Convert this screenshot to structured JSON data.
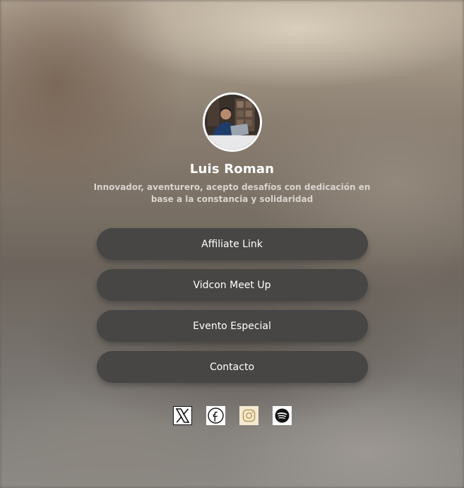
{
  "profile": {
    "name": "Luis Roman",
    "bio": "Innovador, aventurero, acepto desafíos con dedicación en base a la constancia y solidaridad"
  },
  "links": [
    {
      "label": "Affiliate Link"
    },
    {
      "label": "Vidcon Meet Up"
    },
    {
      "label": "Evento Especial"
    },
    {
      "label": "Contacto"
    }
  ],
  "socials": [
    {
      "icon": "x-twitter-icon"
    },
    {
      "icon": "facebook-icon"
    },
    {
      "icon": "instagram-icon"
    },
    {
      "icon": "spotify-icon"
    }
  ],
  "colors": {
    "button_bg": "#474645",
    "button_text": "#ffffff",
    "name_text": "#ffffff",
    "bio_text": "#d9d4ce"
  }
}
